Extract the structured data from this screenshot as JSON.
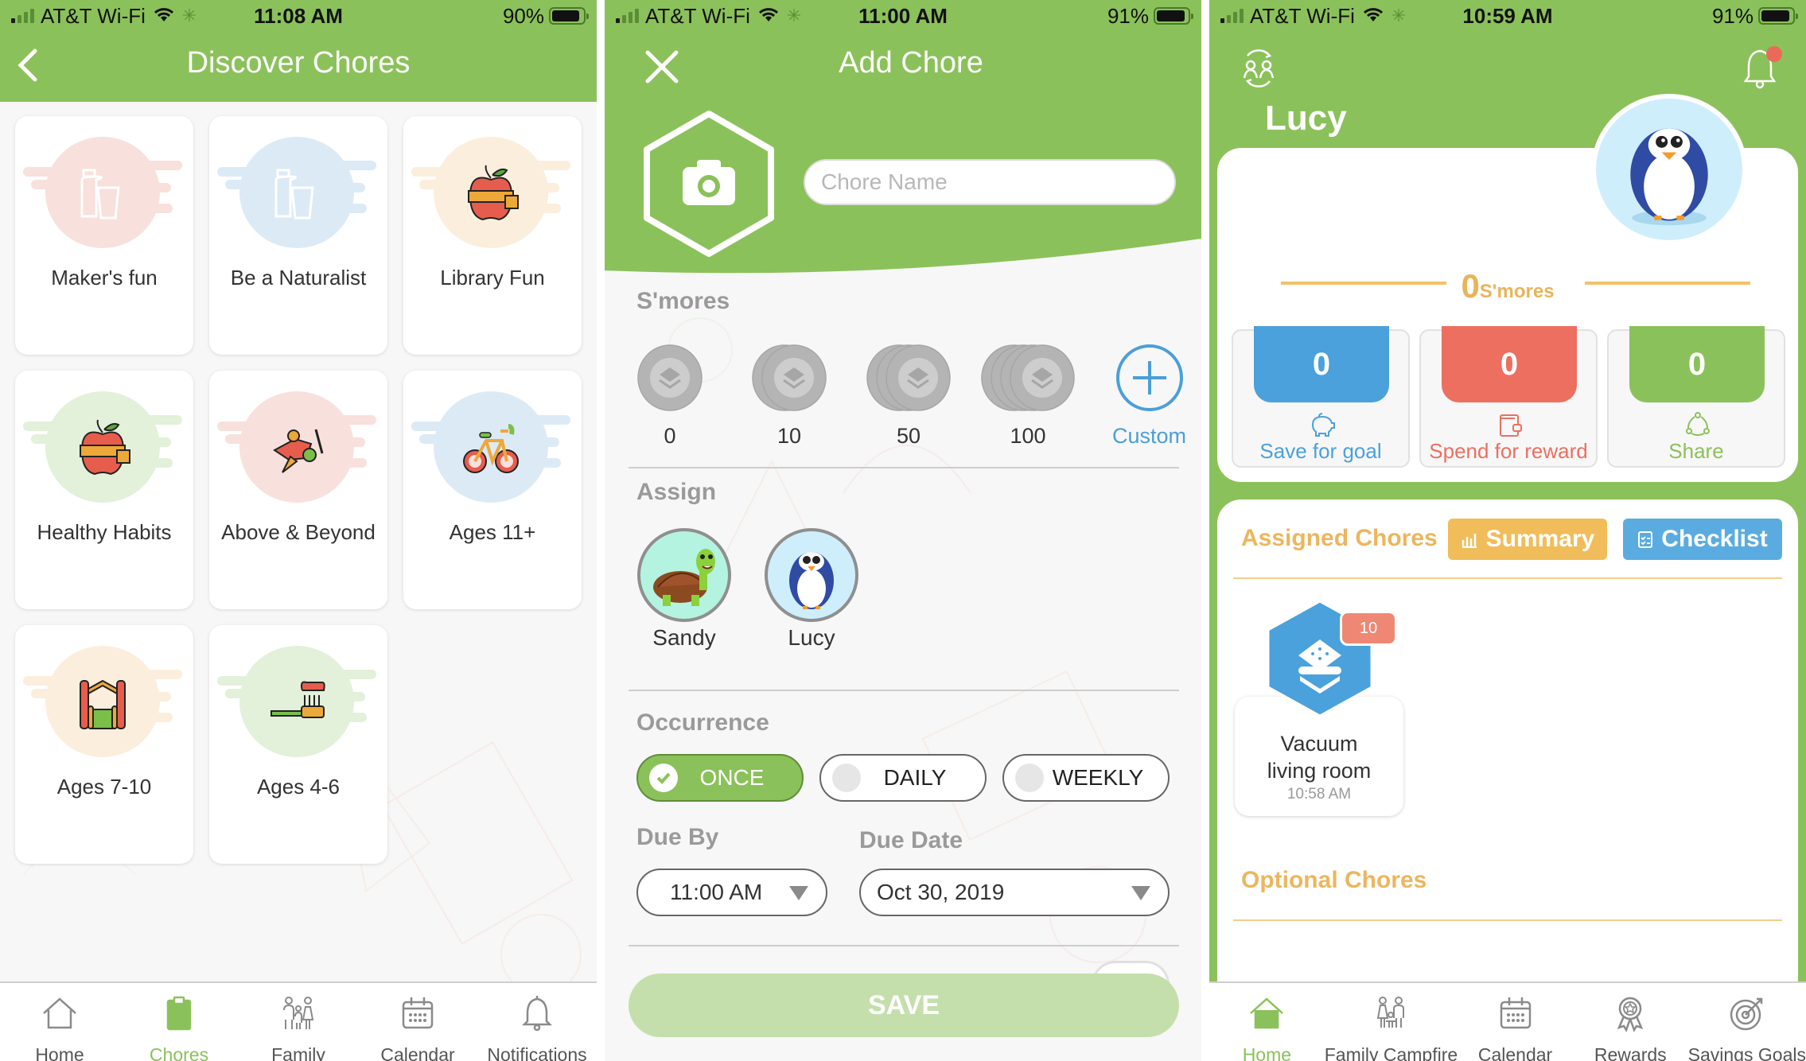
{
  "screens": {
    "discover": {
      "status": {
        "carrier": "AT&T Wi-Fi",
        "time": "11:08 AM",
        "battery": "90%",
        "battery_level": 0.9
      },
      "header": {
        "title": "Discover Chores",
        "back_icon": "chevron-left-icon"
      },
      "categories": [
        {
          "label": "Maker's fun",
          "icon": "bottle-glass-icon",
          "tint": "#f8e0dd"
        },
        {
          "label": "Be a Naturalist",
          "icon": "bottle-glass-icon",
          "tint": "#dceaf6"
        },
        {
          "label": "Library Fun",
          "icon": "apple-measure-icon",
          "tint": "#fbeedc"
        },
        {
          "label": "Healthy Habits",
          "icon": "apple-measure-icon",
          "tint": "#e3f0da"
        },
        {
          "label": "Above & Beyond",
          "icon": "airplane-icon",
          "tint": "#f8e0dd"
        },
        {
          "label": "Ages 11+",
          "icon": "bicycle-icon",
          "tint": "#dceaf6"
        },
        {
          "label": "Ages 7-10",
          "icon": "playground-icon",
          "tint": "#fbeedc"
        },
        {
          "label": "Ages 4-6",
          "icon": "toothbrush-icon",
          "tint": "#e3f0da"
        }
      ],
      "tabs": [
        {
          "label": "Home",
          "icon": "home-icon",
          "active": false
        },
        {
          "label": "Chores",
          "icon": "clipboard-icon",
          "active": true
        },
        {
          "label": "Family",
          "icon": "family-icon",
          "active": false
        },
        {
          "label": "Calendar",
          "icon": "calendar-icon",
          "active": false
        },
        {
          "label": "Notifications",
          "icon": "bell-icon",
          "active": false
        }
      ]
    },
    "add_chore": {
      "status": {
        "carrier": "AT&T Wi-Fi",
        "time": "11:00 AM",
        "battery": "91%",
        "battery_level": 0.91
      },
      "header": {
        "title": "Add Chore",
        "close_icon": "close-icon",
        "photo_icon": "camera-icon"
      },
      "chore_name": {
        "value": "",
        "placeholder": "Chore Name"
      },
      "smores": {
        "label": "S'mores",
        "options": [
          "0",
          "10",
          "50",
          "100"
        ],
        "custom_label": "Custom"
      },
      "assign": {
        "label": "Assign",
        "kids": [
          {
            "name": "Sandy",
            "avatar": "turtle-avatar"
          },
          {
            "name": "Lucy",
            "avatar": "penguin-avatar"
          }
        ]
      },
      "occurrence": {
        "label": "Occurrence",
        "options": [
          {
            "label": "ONCE",
            "selected": true
          },
          {
            "label": "DAILY",
            "selected": false
          },
          {
            "label": "WEEKLY",
            "selected": false
          }
        ]
      },
      "due_by": {
        "label": "Due By",
        "value": "11:00 AM"
      },
      "due_date": {
        "label": "Due Date",
        "value": "Oct 30, 2019"
      },
      "save_label": "SAVE"
    },
    "kid_home": {
      "status": {
        "carrier": "AT&T Wi-Fi",
        "time": "10:59 AM",
        "battery": "91%",
        "battery_level": 0.91
      },
      "kid_name": "Lucy",
      "smores_total": {
        "value": "0",
        "unit": "S'mores"
      },
      "jars": [
        {
          "value": "0",
          "label": "Save for goal",
          "icon": "piggy-bank-icon",
          "color": "#4aa1db"
        },
        {
          "value": "0",
          "label": "Spend for reward",
          "icon": "wallet-icon",
          "color": "#ec6f60"
        },
        {
          "value": "0",
          "label": "Share",
          "icon": "share-icon",
          "color": "#8bc15a"
        }
      ],
      "assigned": {
        "title": "Assigned Chores",
        "summary_label": "Summary",
        "checklist_label": "Checklist",
        "chores": [
          {
            "name_line1": "Vacuum",
            "name_line2": "living room",
            "time": "10:58 AM",
            "smores": "10"
          }
        ]
      },
      "optional_title": "Optional Chores",
      "tabs": [
        {
          "label": "Home",
          "icon": "home-icon",
          "active": true
        },
        {
          "label": "Family Campfire",
          "icon": "family-campfire-icon",
          "active": false
        },
        {
          "label": "Calendar",
          "icon": "calendar-icon",
          "active": false
        },
        {
          "label": "Rewards",
          "icon": "award-icon",
          "active": false
        },
        {
          "label": "Savings Goals",
          "icon": "target-icon",
          "active": false
        }
      ]
    }
  },
  "colors": {
    "brand_green": "#8bc15a",
    "save_blue": "#4aa1db",
    "spend_red": "#ec6f60",
    "accent_orange": "#ecb65e",
    "checklist_blue": "#5aace0",
    "summary_orange": "#f0bd5a"
  }
}
